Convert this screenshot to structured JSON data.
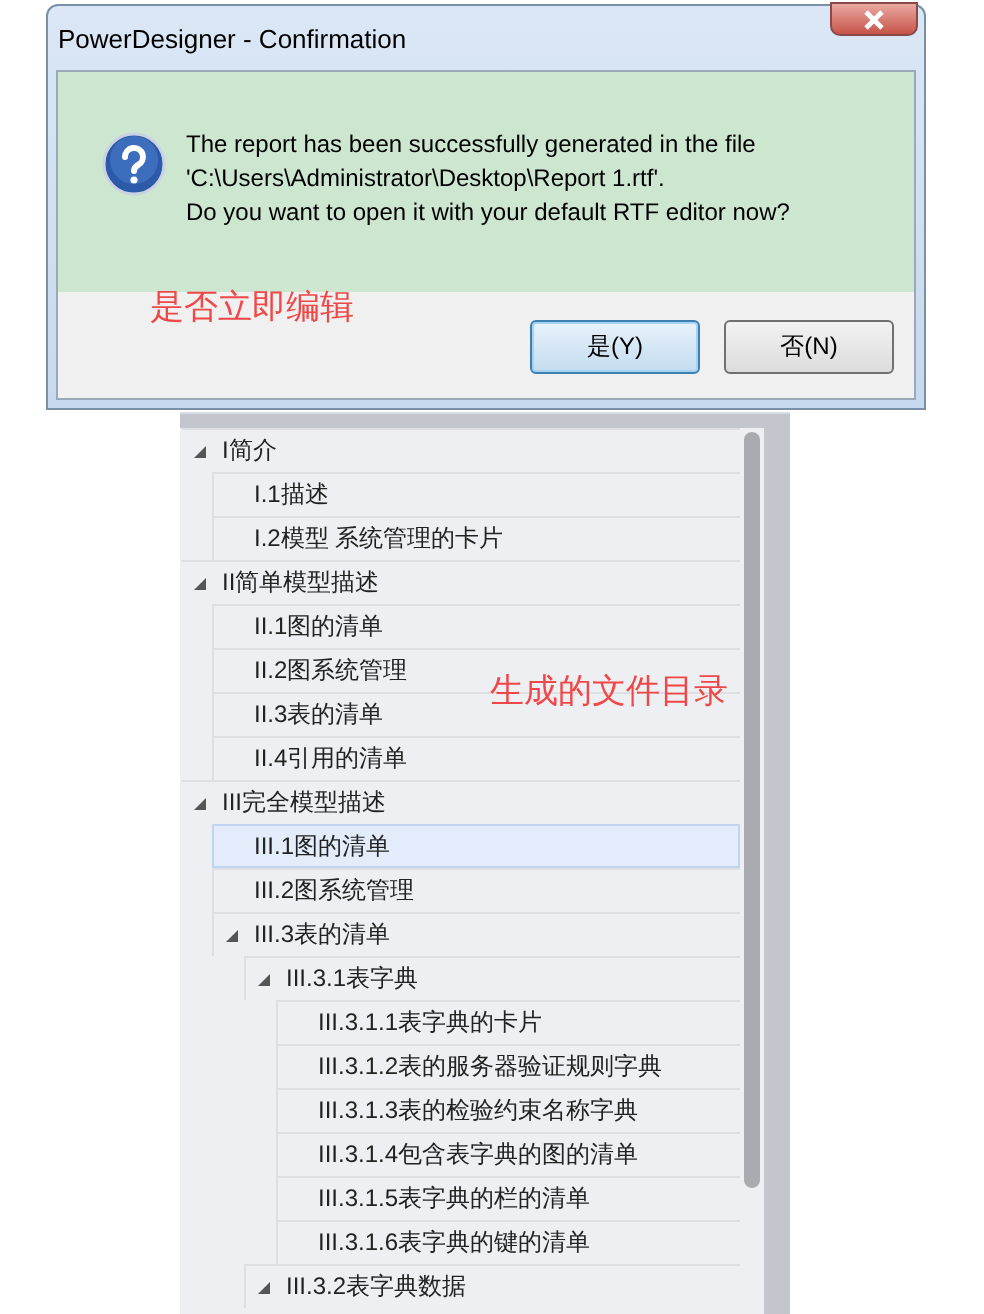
{
  "dialog": {
    "title": "PowerDesigner - Confirmation",
    "message_lines": [
      "The report has been successfully generated in the file",
      "'C:\\Users\\Administrator\\Desktop\\Report 1.rtf'.",
      "Do you want to open it with your default RTF editor now?"
    ],
    "annotation": "是否立即编辑",
    "buttons": [
      {
        "label": "是(Y)",
        "default": true
      },
      {
        "label": "否(N)",
        "default": false
      }
    ]
  },
  "tree": {
    "annotation": "生成的文件目录",
    "items": [
      {
        "label": "I简介",
        "expanded": true,
        "selected": false,
        "children": [
          {
            "label": "I.1描述",
            "selected": false
          },
          {
            "label": "I.2模型  系统管理的卡片",
            "selected": false
          }
        ]
      },
      {
        "label": "II简单模型描述",
        "expanded": true,
        "selected": false,
        "children": [
          {
            "label": "II.1图的清单",
            "selected": false
          },
          {
            "label": "II.2图系统管理",
            "selected": false
          },
          {
            "label": "II.3表的清单",
            "selected": false
          },
          {
            "label": "II.4引用的清单",
            "selected": false
          }
        ]
      },
      {
        "label": "III完全模型描述",
        "expanded": true,
        "selected": false,
        "children": [
          {
            "label": "III.1图的清单",
            "selected": true
          },
          {
            "label": "III.2图系统管理",
            "selected": false
          },
          {
            "label": "III.3表的清单",
            "expanded": true,
            "selected": false,
            "children": [
              {
                "label": "III.3.1表字典",
                "expanded": true,
                "selected": false,
                "children": [
                  {
                    "label": "III.3.1.1表字典的卡片",
                    "selected": false
                  },
                  {
                    "label": "III.3.1.2表的服务器验证规则字典",
                    "selected": false
                  },
                  {
                    "label": "III.3.1.3表的检验约束名称字典",
                    "selected": false
                  },
                  {
                    "label": "III.3.1.4包含表字典的图的清单",
                    "selected": false
                  },
                  {
                    "label": "III.3.1.5表字典的栏的清单",
                    "selected": false
                  },
                  {
                    "label": "III.3.1.6表字典的键的清单",
                    "selected": false
                  }
                ]
              },
              {
                "label": "III.3.2表字典数据",
                "expanded": true,
                "selected": false
              }
            ]
          }
        ]
      }
    ]
  }
}
